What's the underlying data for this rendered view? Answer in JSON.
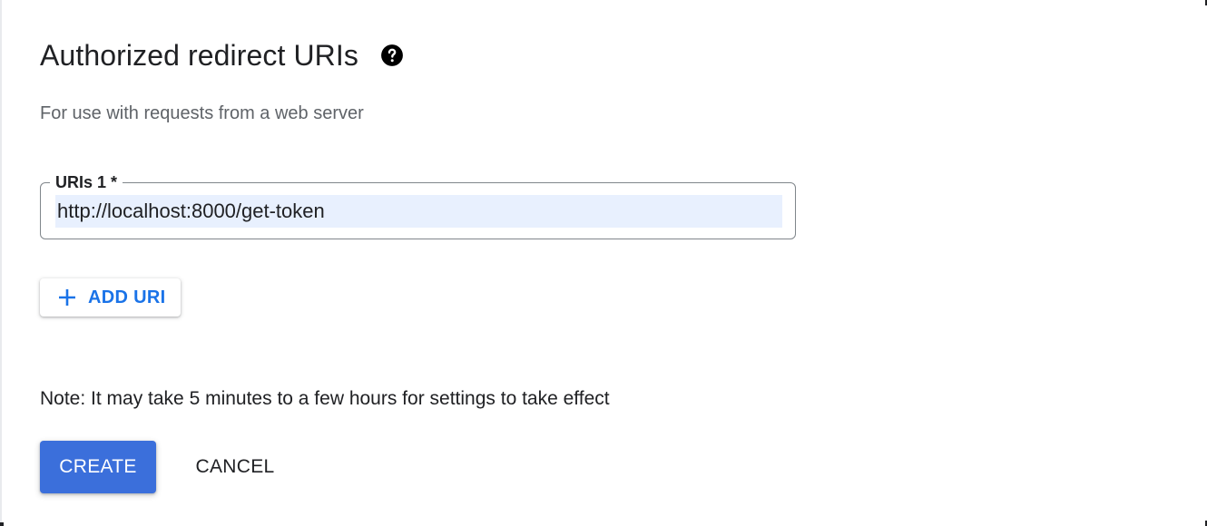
{
  "section": {
    "title": "Authorized redirect URIs",
    "help_icon": "help-circle-icon",
    "subtitle": "For use with requests from a web server"
  },
  "uri_field": {
    "label": "URIs 1 *",
    "value": "http://localhost:8000/get-token"
  },
  "add_uri_button": {
    "icon": "plus-icon",
    "label": "ADD URI"
  },
  "note": "Note: It may take 5 minutes to a few hours for settings to take effect",
  "actions": {
    "create_label": "CREATE",
    "cancel_label": "CANCEL"
  },
  "colors": {
    "accent": "#1a73e8",
    "primary_button": "#3b6fdb",
    "input_autofill": "#e8f0fe"
  }
}
